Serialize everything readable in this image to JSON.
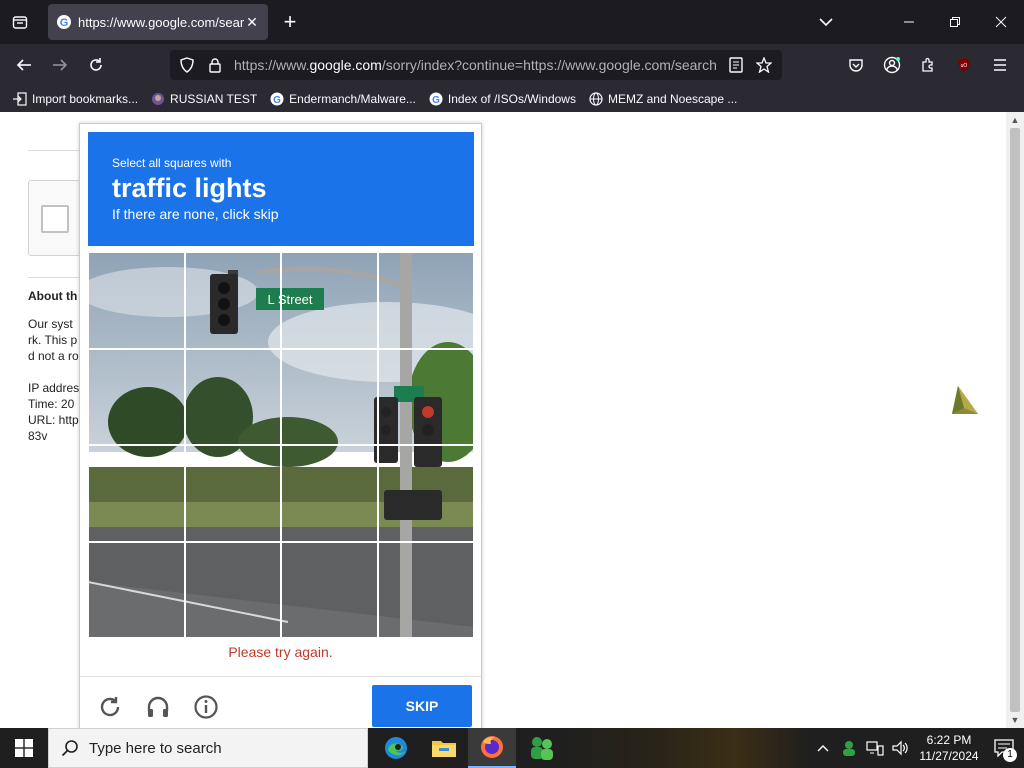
{
  "browser": {
    "tab": {
      "title": "https://www.google.com/search"
    },
    "url": {
      "prefix": "https://www.",
      "host": "google.com",
      "rest": "/sorry/index?continue=https://www.google.com/search"
    },
    "bookmarks": [
      {
        "label": "Import bookmarks...",
        "icon": "import-icon"
      },
      {
        "label": "RUSSIAN TEST",
        "icon": "github-icon"
      },
      {
        "label": "Endermanch/Malware...",
        "icon": "google-icon"
      },
      {
        "label": "Index of /ISOs/Windows",
        "icon": "google-icon"
      },
      {
        "label": "MEMZ and Noescape ...",
        "icon": "globe-icon"
      }
    ]
  },
  "page": {
    "about": {
      "heading": "About th",
      "lines": [
        "Our syst",
        "rk. This p",
        "d not a ro",
        "",
        "IP addres",
        "Time: 20",
        "URL: http",
        "83v"
      ]
    }
  },
  "captcha": {
    "header": {
      "line1": "Select all squares with",
      "line2": "traffic lights",
      "line3": "If there are none, click skip"
    },
    "error": "Please try again.",
    "skip_label": "SKIP",
    "accent_color": "#1a73e8"
  },
  "taskbar": {
    "search_placeholder": "Type here to search",
    "time": "6:22 PM",
    "date": "11/27/2024",
    "notification_count": "1"
  }
}
